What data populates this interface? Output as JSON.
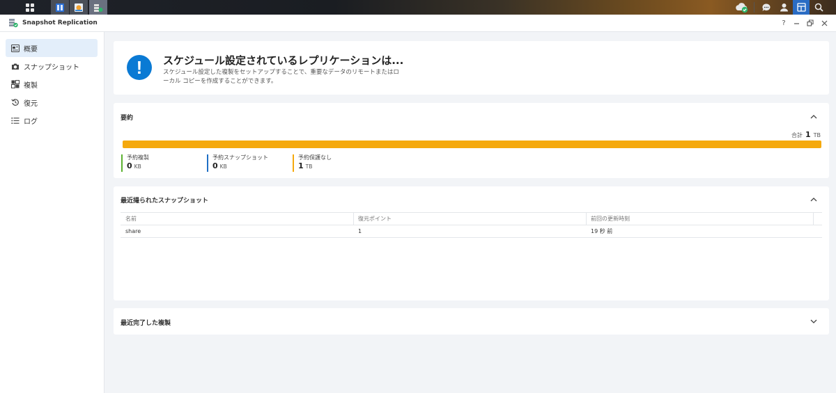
{
  "window": {
    "title": "Snapshot Replication"
  },
  "sidebar": {
    "items": [
      {
        "label": "概要",
        "icon": "overview-icon",
        "active": true
      },
      {
        "label": "スナップショット",
        "icon": "camera-icon",
        "active": false
      },
      {
        "label": "複製",
        "icon": "replication-icon",
        "active": false
      },
      {
        "label": "復元",
        "icon": "restore-icon",
        "active": false
      },
      {
        "label": "ログ",
        "icon": "log-list-icon",
        "active": false
      }
    ]
  },
  "banner": {
    "icon": "!",
    "title": "スケジュール設定されているレプリケーションは...",
    "desc_line1": "スケジュール設定した複製をセットアップすることで、重要なデータのリモートまたはロ",
    "desc_line2": "ーカル コピーを作成することができます。"
  },
  "summary": {
    "title": "要約",
    "total_label": "合計",
    "total_value": "1",
    "total_unit": "TB",
    "bar_fill_fraction": 1.0,
    "stats": [
      {
        "label": "予約複製",
        "value": "0",
        "unit": "KB",
        "color": "#5bb130"
      },
      {
        "label": "予約スナップショット",
        "value": "0",
        "unit": "KB",
        "color": "#1f6fc5"
      },
      {
        "label": "予約保護なし",
        "value": "1",
        "unit": "TB",
        "color": "#f5a90d"
      }
    ]
  },
  "snapshots": {
    "title": "最近撮られたスナップショット",
    "columns": [
      "名前",
      "復元ポイント",
      "前回の更新時刻"
    ],
    "rows": [
      {
        "name": "share",
        "points": "1",
        "updated": "19 秒 前"
      }
    ]
  },
  "replications": {
    "title": "最近完了した複製"
  },
  "window_controls": {
    "help": "?"
  },
  "colors": {
    "accent": "#0a7ad4",
    "bar": "#f5a90d",
    "active_bg": "#e3eefa"
  }
}
